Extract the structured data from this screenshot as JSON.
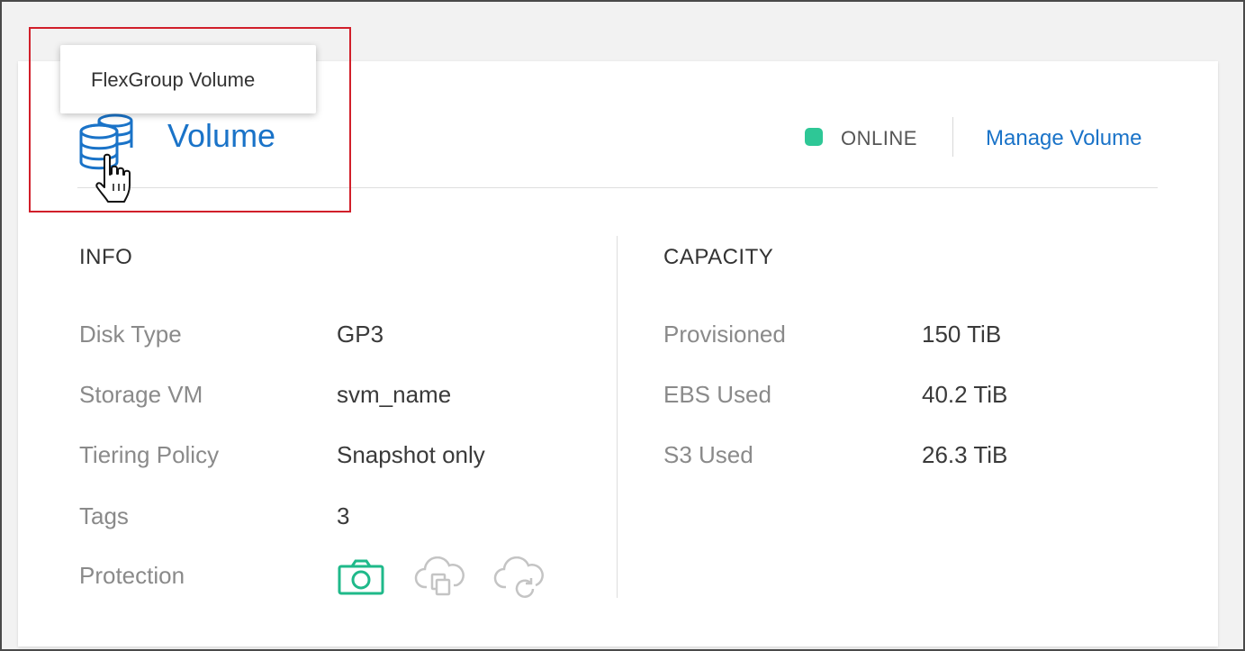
{
  "volume": {
    "title": "Volume",
    "tooltip": "FlexGroup Volume",
    "status": "ONLINE",
    "status_color": "#2ec796",
    "manage_label": "Manage Volume",
    "icon": "database-stack-icon"
  },
  "info": {
    "heading": "INFO",
    "rows": [
      {
        "label": "Disk Type",
        "value": "GP3"
      },
      {
        "label": "Storage VM",
        "value": "svm_name"
      },
      {
        "label": "Tiering Policy",
        "value": "Snapshot only"
      },
      {
        "label": "Tags",
        "value": "3"
      },
      {
        "label": "Protection",
        "value": ""
      }
    ],
    "protection_icons": [
      "camera-snapshot-icon",
      "cloud-copy-icon",
      "cloud-backup-icon"
    ]
  },
  "capacity": {
    "heading": "CAPACITY",
    "rows": [
      {
        "label": "Provisioned",
        "value": "150 TiB"
      },
      {
        "label": "EBS Used",
        "value": "40.2 TiB"
      },
      {
        "label": "S3 Used",
        "value": "26.3 TiB"
      }
    ]
  },
  "colors": {
    "accent": "#1a73c8",
    "online": "#2ec796",
    "highlight": "#d11f2a"
  }
}
